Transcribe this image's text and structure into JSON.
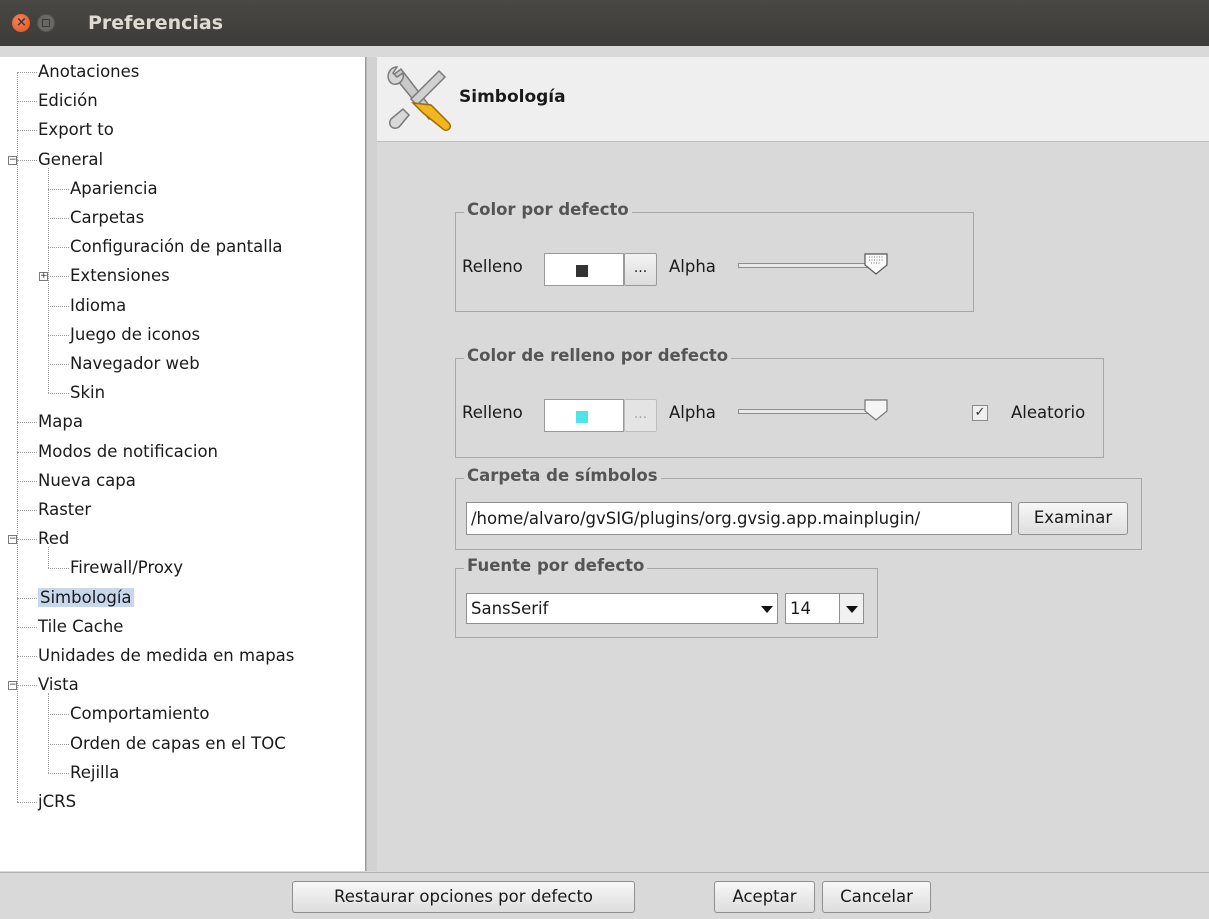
{
  "window": {
    "title": "Preferencias"
  },
  "tree": {
    "items": [
      {
        "label": "Anotaciones"
      },
      {
        "label": "Edición"
      },
      {
        "label": "Export to"
      },
      {
        "label": "General"
      },
      {
        "label": "Apariencia"
      },
      {
        "label": "Carpetas"
      },
      {
        "label": "Configuración de pantalla"
      },
      {
        "label": "Extensiones"
      },
      {
        "label": "Idioma"
      },
      {
        "label": "Juego de iconos"
      },
      {
        "label": "Navegador web"
      },
      {
        "label": "Skin"
      },
      {
        "label": "Mapa"
      },
      {
        "label": "Modos de notificacion"
      },
      {
        "label": "Nueva capa"
      },
      {
        "label": "Raster"
      },
      {
        "label": "Red"
      },
      {
        "label": "Firewall/Proxy"
      },
      {
        "label": "Simbología"
      },
      {
        "label": "Tile Cache"
      },
      {
        "label": "Unidades de medida en mapas"
      },
      {
        "label": "Vista"
      },
      {
        "label": "Comportamiento"
      },
      {
        "label": "Orden de capas en el TOC"
      },
      {
        "label": "Rejilla"
      },
      {
        "label": "jCRS"
      }
    ],
    "selected": "Simbología"
  },
  "panel": {
    "title": "Simbología",
    "color_por_defecto": {
      "legend": "Color por defecto",
      "fill_label": "Relleno",
      "button": "...",
      "alpha_label": "Alpha",
      "swatch_color": "#333333",
      "alpha_level": 1.0
    },
    "color_relleno": {
      "legend": "Color de relleno por defecto",
      "fill_label": "Relleno",
      "button": "...",
      "alpha_label": "Alpha",
      "swatch_color": "#4fe3ea",
      "alpha_level": 1.0,
      "random_label": "Aleatorio",
      "random_checked": true
    },
    "carpeta": {
      "legend": "Carpeta de símbolos",
      "path": "/home/alvaro/gvSIG/plugins/org.gvsig.app.mainplugin/",
      "browse_button": "Examinar"
    },
    "fuente": {
      "legend": "Fuente por defecto",
      "font": "SansSerif",
      "size": "14"
    }
  },
  "buttons": {
    "restore": "Restaurar opciones por defecto",
    "accept": "Aceptar",
    "cancel": "Cancelar"
  }
}
